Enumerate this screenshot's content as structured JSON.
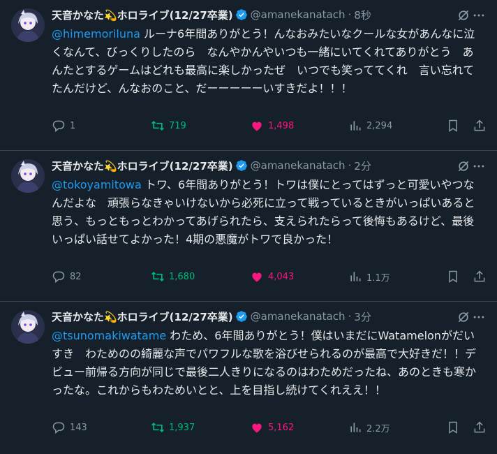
{
  "tweets": [
    {
      "name": "天音かなた💫ホロライブ(12/27卒業)",
      "handle": "@amanekanatach",
      "time": "8秒",
      "mention": "@himemoriluna",
      "text": " ルーナ6年間ありがとう！んなおみたいなクールな女があんなに泣くなんて、びっくりしたのら　なんやかんやいつも一緒にいてくれてありがとう　あんたとするゲームはどれも最高に楽しかったぜ　いつでも笑っててくれ　言い忘れてたんだけど、んなおのこと、だーーーーーいすきだよ！！！",
      "replies": "1",
      "retweets": "719",
      "likes": "1,498",
      "views": "2,294"
    },
    {
      "name": "天音かなた💫ホロライブ(12/27卒業)",
      "handle": "@amanekanatach",
      "time": "2分",
      "mention": "@tokoyamitowa",
      "text": " トワ、6年間ありがとう！トワは僕にとってはずっと可愛いやつなんだよな　頑張らなきゃいけないから必死に立って戦っているときがいっぱいあると思う、もっともっとわかってあげられたら、支えられたらって後悔もあるけど、最後いっぱい話せてよかった！4期の悪魔がトワで良かった！",
      "replies": "82",
      "retweets": "1,680",
      "likes": "4,043",
      "views": "1.1万"
    },
    {
      "name": "天音かなた💫ホロライブ(12/27卒業)",
      "handle": "@amanekanatach",
      "time": "3分",
      "mention": "@tsunomakiwatame",
      "text": " わため、6年間ありがとう！僕はいまだにWatamelonがだいすき　わためのの綺麗な声でパワフルな歌を浴びせられるのが最高で大好きだ！！デビュー前帰る方向が同じで最後二人きりになるのはわためだったね、あのときも寒かったな。これからもわためいとと、上を目指し続けてくれええ！！",
      "replies": "143",
      "retweets": "1,937",
      "likes": "5,162",
      "views": "2.2万"
    }
  ],
  "icons": {
    "verified": "verified-badge-icon",
    "grok": "grok-icon",
    "more": "more-icon",
    "reply": "reply-icon",
    "retweet": "retweet-icon",
    "like": "heart-icon",
    "views": "views-icon",
    "bookmark": "bookmark-icon",
    "share": "share-icon"
  },
  "colors": {
    "background": "#15202b",
    "mention": "#1d9bf0",
    "retweet": "#00ba7c",
    "like": "#f91880",
    "muted": "#8b98a5"
  }
}
